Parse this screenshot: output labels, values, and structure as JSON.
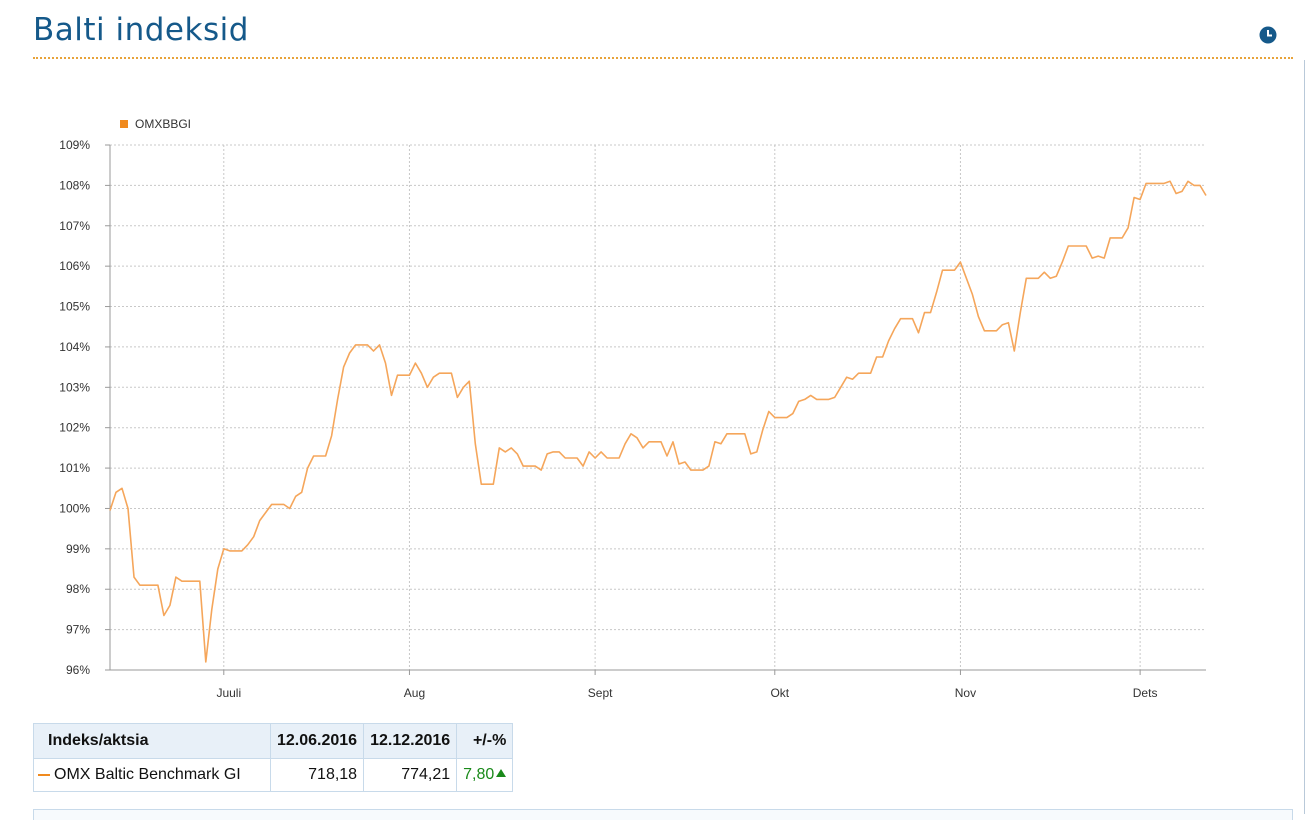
{
  "header": {
    "title": "Balti indeksid"
  },
  "chart_data": {
    "type": "line",
    "legend": "top-left",
    "grid": true,
    "ylim": [
      96,
      109
    ],
    "ytick_labels": [
      "96%",
      "97%",
      "98%",
      "99%",
      "100%",
      "101%",
      "102%",
      "103%",
      "104%",
      "105%",
      "106%",
      "107%",
      "108%",
      "109%"
    ],
    "yticks": [
      96,
      97,
      98,
      99,
      100,
      101,
      102,
      103,
      104,
      105,
      106,
      107,
      108,
      109
    ],
    "xlim": [
      "2016-06-12",
      "2016-12-12"
    ],
    "xticks": [
      {
        "label": "Juuli",
        "date": "2016-07-01"
      },
      {
        "label": "Aug",
        "date": "2016-08-01"
      },
      {
        "label": "Sept",
        "date": "2016-09-01"
      },
      {
        "label": "Okt",
        "date": "2016-10-01"
      },
      {
        "label": "Nov",
        "date": "2016-11-01"
      },
      {
        "label": "Dets",
        "date": "2016-12-01"
      }
    ],
    "series": [
      {
        "name": "OMXBBGI",
        "color": "#f5a65b",
        "points": [
          [
            "2016-06-12",
            99.95
          ],
          [
            "2016-06-13",
            100.4
          ],
          [
            "2016-06-14",
            100.5
          ],
          [
            "2016-06-15",
            100.0
          ],
          [
            "2016-06-16",
            98.3
          ],
          [
            "2016-06-17",
            98.1
          ],
          [
            "2016-06-19",
            98.1
          ],
          [
            "2016-06-20",
            98.1
          ],
          [
            "2016-06-21",
            97.35
          ],
          [
            "2016-06-22",
            97.6
          ],
          [
            "2016-06-23",
            98.3
          ],
          [
            "2016-06-24",
            98.2
          ],
          [
            "2016-06-26",
            98.2
          ],
          [
            "2016-06-27",
            98.2
          ],
          [
            "2016-06-28",
            96.2
          ],
          [
            "2016-06-29",
            97.5
          ],
          [
            "2016-06-30",
            98.5
          ],
          [
            "2016-07-01",
            99.0
          ],
          [
            "2016-07-02",
            98.95
          ],
          [
            "2016-07-04",
            98.95
          ],
          [
            "2016-07-05",
            99.1
          ],
          [
            "2016-07-06",
            99.3
          ],
          [
            "2016-07-07",
            99.7
          ],
          [
            "2016-07-08",
            99.9
          ],
          [
            "2016-07-09",
            100.1
          ],
          [
            "2016-07-11",
            100.1
          ],
          [
            "2016-07-12",
            100.0
          ],
          [
            "2016-07-13",
            100.3
          ],
          [
            "2016-07-14",
            100.4
          ],
          [
            "2016-07-15",
            101.0
          ],
          [
            "2016-07-16",
            101.3
          ],
          [
            "2016-07-18",
            101.3
          ],
          [
            "2016-07-19",
            101.8
          ],
          [
            "2016-07-20",
            102.7
          ],
          [
            "2016-07-21",
            103.5
          ],
          [
            "2016-07-22",
            103.85
          ],
          [
            "2016-07-23",
            104.05
          ],
          [
            "2016-07-25",
            104.05
          ],
          [
            "2016-07-26",
            103.9
          ],
          [
            "2016-07-27",
            104.05
          ],
          [
            "2016-07-28",
            103.6
          ],
          [
            "2016-07-29",
            102.8
          ],
          [
            "2016-07-30",
            103.3
          ],
          [
            "2016-07-31",
            103.3
          ],
          [
            "2016-08-01",
            103.3
          ],
          [
            "2016-08-02",
            103.6
          ],
          [
            "2016-08-03",
            103.35
          ],
          [
            "2016-08-04",
            103.0
          ],
          [
            "2016-08-05",
            103.25
          ],
          [
            "2016-08-06",
            103.35
          ],
          [
            "2016-08-08",
            103.35
          ],
          [
            "2016-08-09",
            102.75
          ],
          [
            "2016-08-10",
            103.0
          ],
          [
            "2016-08-11",
            103.15
          ],
          [
            "2016-08-12",
            101.6
          ],
          [
            "2016-08-13",
            100.6
          ],
          [
            "2016-08-15",
            100.6
          ],
          [
            "2016-08-16",
            101.5
          ],
          [
            "2016-08-17",
            101.4
          ],
          [
            "2016-08-18",
            101.5
          ],
          [
            "2016-08-19",
            101.35
          ],
          [
            "2016-08-20",
            101.05
          ],
          [
            "2016-08-22",
            101.05
          ],
          [
            "2016-08-23",
            100.95
          ],
          [
            "2016-08-24",
            101.35
          ],
          [
            "2016-08-25",
            101.4
          ],
          [
            "2016-08-26",
            101.4
          ],
          [
            "2016-08-27",
            101.25
          ],
          [
            "2016-08-29",
            101.25
          ],
          [
            "2016-08-30",
            101.05
          ],
          [
            "2016-08-31",
            101.4
          ],
          [
            "2016-09-01",
            101.25
          ],
          [
            "2016-09-02",
            101.4
          ],
          [
            "2016-09-03",
            101.25
          ],
          [
            "2016-09-05",
            101.25
          ],
          [
            "2016-09-06",
            101.6
          ],
          [
            "2016-09-07",
            101.85
          ],
          [
            "2016-09-08",
            101.75
          ],
          [
            "2016-09-09",
            101.5
          ],
          [
            "2016-09-10",
            101.65
          ],
          [
            "2016-09-12",
            101.65
          ],
          [
            "2016-09-13",
            101.3
          ],
          [
            "2016-09-14",
            101.65
          ],
          [
            "2016-09-15",
            101.1
          ],
          [
            "2016-09-16",
            101.15
          ],
          [
            "2016-09-17",
            100.95
          ],
          [
            "2016-09-19",
            100.95
          ],
          [
            "2016-09-20",
            101.05
          ],
          [
            "2016-09-21",
            101.65
          ],
          [
            "2016-09-22",
            101.6
          ],
          [
            "2016-09-23",
            101.85
          ],
          [
            "2016-09-24",
            101.85
          ],
          [
            "2016-09-26",
            101.85
          ],
          [
            "2016-09-27",
            101.35
          ],
          [
            "2016-09-28",
            101.4
          ],
          [
            "2016-09-29",
            101.95
          ],
          [
            "2016-09-30",
            102.4
          ],
          [
            "2016-10-01",
            102.25
          ],
          [
            "2016-10-03",
            102.25
          ],
          [
            "2016-10-04",
            102.35
          ],
          [
            "2016-10-05",
            102.65
          ],
          [
            "2016-10-06",
            102.7
          ],
          [
            "2016-10-07",
            102.8
          ],
          [
            "2016-10-08",
            102.7
          ],
          [
            "2016-10-10",
            102.7
          ],
          [
            "2016-10-11",
            102.75
          ],
          [
            "2016-10-12",
            103.0
          ],
          [
            "2016-10-13",
            103.25
          ],
          [
            "2016-10-14",
            103.2
          ],
          [
            "2016-10-15",
            103.35
          ],
          [
            "2016-10-17",
            103.35
          ],
          [
            "2016-10-18",
            103.75
          ],
          [
            "2016-10-19",
            103.75
          ],
          [
            "2016-10-20",
            104.15
          ],
          [
            "2016-10-21",
            104.45
          ],
          [
            "2016-10-22",
            104.7
          ],
          [
            "2016-10-24",
            104.7
          ],
          [
            "2016-10-25",
            104.35
          ],
          [
            "2016-10-26",
            104.85
          ],
          [
            "2016-10-27",
            104.85
          ],
          [
            "2016-10-28",
            105.35
          ],
          [
            "2016-10-29",
            105.9
          ],
          [
            "2016-10-31",
            105.9
          ],
          [
            "2016-11-01",
            106.1
          ],
          [
            "2016-11-02",
            105.7
          ],
          [
            "2016-11-03",
            105.3
          ],
          [
            "2016-11-04",
            104.75
          ],
          [
            "2016-11-05",
            104.4
          ],
          [
            "2016-11-07",
            104.4
          ],
          [
            "2016-11-08",
            104.55
          ],
          [
            "2016-11-09",
            104.6
          ],
          [
            "2016-11-10",
            103.9
          ],
          [
            "2016-11-11",
            104.85
          ],
          [
            "2016-11-12",
            105.7
          ],
          [
            "2016-11-14",
            105.7
          ],
          [
            "2016-11-15",
            105.85
          ],
          [
            "2016-11-16",
            105.7
          ],
          [
            "2016-11-17",
            105.75
          ],
          [
            "2016-11-18",
            106.1
          ],
          [
            "2016-11-19",
            106.5
          ],
          [
            "2016-11-21",
            106.5
          ],
          [
            "2016-11-22",
            106.5
          ],
          [
            "2016-11-23",
            106.2
          ],
          [
            "2016-11-24",
            106.25
          ],
          [
            "2016-11-25",
            106.2
          ],
          [
            "2016-11-26",
            106.7
          ],
          [
            "2016-11-28",
            106.7
          ],
          [
            "2016-11-29",
            106.95
          ],
          [
            "2016-11-30",
            107.7
          ],
          [
            "2016-12-01",
            107.65
          ],
          [
            "2016-12-02",
            108.05
          ],
          [
            "2016-12-04",
            108.05
          ],
          [
            "2016-12-05",
            108.05
          ],
          [
            "2016-12-06",
            108.1
          ],
          [
            "2016-12-07",
            107.8
          ],
          [
            "2016-12-08",
            107.85
          ],
          [
            "2016-12-09",
            108.1
          ],
          [
            "2016-12-10",
            108.0
          ],
          [
            "2016-12-11",
            108.0
          ],
          [
            "2016-12-12",
            107.75
          ]
        ]
      }
    ]
  },
  "table": {
    "headers": [
      "Indeks/aktsia",
      "12.06.2016",
      "12.12.2016",
      "+/-%"
    ],
    "rows": [
      {
        "name": "OMX Baltic Benchmark GI",
        "start": "718,18",
        "end": "774,21",
        "change": "7,80"
      }
    ]
  },
  "colors": {
    "accent": "#15598a",
    "line": "#f5a65b",
    "grid": "#cccccc",
    "positive": "#1a8a1a"
  },
  "icons": {
    "header_icon": "clock-icon"
  }
}
